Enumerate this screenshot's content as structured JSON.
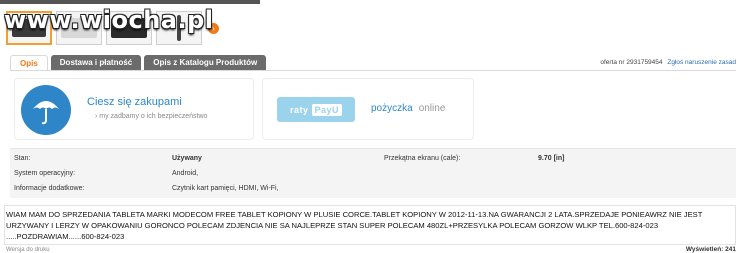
{
  "watermark": "www.wiocha.pl",
  "thumbnails": {
    "next_icon": "chevron-right-icon",
    "next_glyph": "›"
  },
  "tabs": [
    {
      "label": "Opis",
      "active": true
    },
    {
      "label": "Dostawa i płatność",
      "active": false
    },
    {
      "label": "Opis z Katalogu Produktów",
      "active": false
    }
  ],
  "offer": {
    "number_text": "oferta nr 2931759454",
    "report_link": "Zgłoś naruszenie zasad"
  },
  "promo": {
    "safe": {
      "title": "Ciesz się zakupami",
      "subtitle": "›  my zadbamy o ich bezpieczeństwo",
      "icon": "umbrella-icon"
    },
    "loan": {
      "badge_left": "raty",
      "badge_right": "PayU",
      "title": "pożyczka",
      "suffix": "online"
    }
  },
  "specs": {
    "row1": {
      "label1": "Stan:",
      "value1": "Używany",
      "label2": "Przekątna ekranu (cale):",
      "value2": "9.70 [in]"
    },
    "row2": {
      "label": "System operacyjny:",
      "value": "Android,"
    },
    "row3": {
      "label": "Informacje dodatkowe:",
      "value": "Czytnik kart pamięci, HDMI, Wi-Fi,"
    }
  },
  "description": "WIAM MAM DO SPRZEDANIA TABLETA MARKI MODECOM FREE TABLET KOPIONY W PLUSIE CORCE.TABLET KOPIONY W 2012-11-13.NA GWARANCJI 2 LATA.SPRZEDAJE PONIEAWRZ NIE JEST URZYWANY I LERZY W OPAKOWANIU GORONCO POLECAM ZDJENCIA NIE SA NAJLEPRZE STAN SUPER POLECAM 480ZL+PRZESYLKA POLECAM GORZOW WLKP TEL.600-824-023 .....POZDRAWIAM......600-824-023",
  "footer": {
    "left": "Wersja do druku",
    "right": "Wyświetleń: 241"
  },
  "colors": {
    "accent": "#f07a1a",
    "brand_blue": "#2e86c8",
    "payu_blue": "#9bd3ec"
  }
}
